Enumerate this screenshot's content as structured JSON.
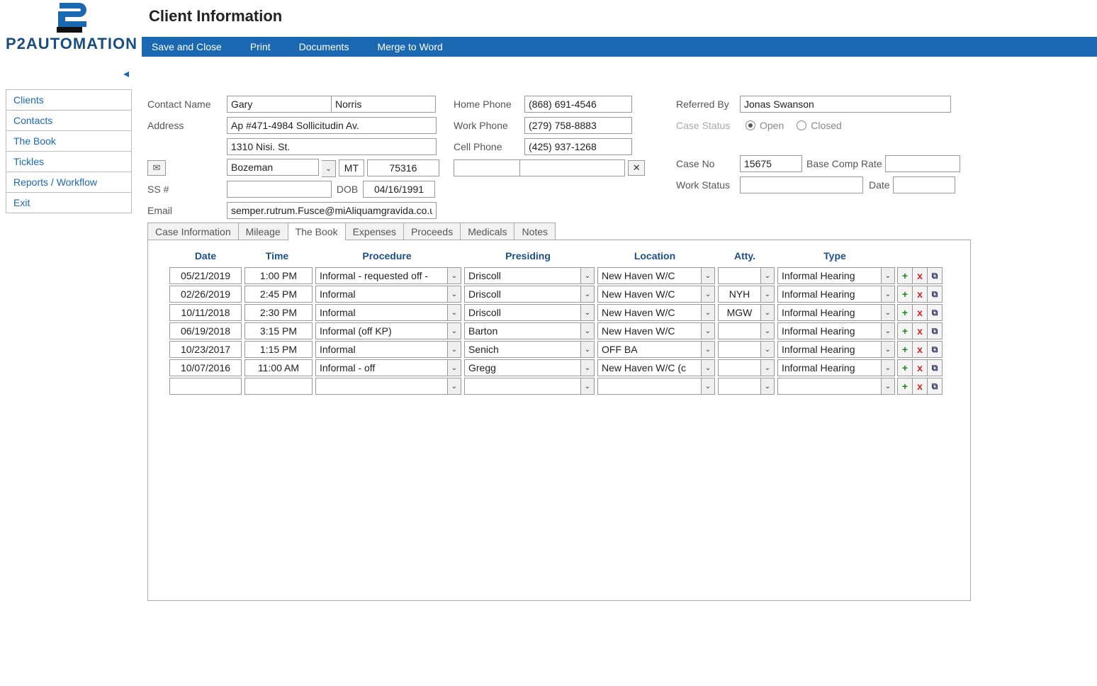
{
  "brand": "P2AUTOMATION",
  "page_title": "Client Information",
  "toolbar": {
    "save_close": "Save and Close",
    "print": "Print",
    "documents": "Documents",
    "merge_word": "Merge to Word"
  },
  "sidebar": {
    "items": [
      {
        "label": "Clients"
      },
      {
        "label": "Contacts"
      },
      {
        "label": "The Book"
      },
      {
        "label": "Tickles"
      },
      {
        "label": "Reports / Workflow"
      },
      {
        "label": "Exit"
      }
    ]
  },
  "labels": {
    "contact_name": "Contact Name",
    "address": "Address",
    "ssn": "SS #",
    "dob": "DOB",
    "email": "Email",
    "home_phone": "Home Phone",
    "work_phone": "Work Phone",
    "cell_phone": "Cell Phone",
    "referred_by": "Referred By",
    "case_status": "Case Status",
    "open": "Open",
    "closed": "Closed",
    "case_no": "Case No",
    "base_comp_rate": "Base Comp Rate",
    "work_status": "Work Status",
    "date": "Date"
  },
  "client": {
    "first_name": "Gary",
    "last_name": "Norris",
    "address1": "Ap #471-4984 Sollicitudin Av.",
    "address2": "1310 Nisi. St.",
    "city": "Bozeman",
    "state": "MT",
    "zip": "75316",
    "ssn": "",
    "dob": "04/16/1991",
    "email": "semper.rutrum.Fusce@miAliquamgravida.co.uk",
    "home_phone": "(868) 691-4546",
    "work_phone": "(279) 758-8883",
    "cell_phone": "(425) 937-1268",
    "phone4": "",
    "phone5": "",
    "referred_by": "Jonas Swanson",
    "case_status": "Open",
    "case_no": "15675",
    "base_comp_rate": "",
    "work_status": "",
    "work_status_date": ""
  },
  "tabs": [
    {
      "label": "Case Information"
    },
    {
      "label": "Mileage"
    },
    {
      "label": "The Book"
    },
    {
      "label": "Expenses"
    },
    {
      "label": "Proceeds"
    },
    {
      "label": "Medicals"
    },
    {
      "label": "Notes"
    }
  ],
  "active_tab": 2,
  "grid": {
    "headers": {
      "date": "Date",
      "time": "Time",
      "procedure": "Procedure",
      "presiding": "Presiding",
      "location": "Location",
      "atty": "Atty.",
      "type": "Type"
    },
    "rows": [
      {
        "date": "05/21/2019",
        "time": "1:00 PM",
        "procedure": "Informal - requested off -",
        "presiding": "Driscoll",
        "location": "New Haven  W/C",
        "atty": "",
        "type": "Informal Hearing"
      },
      {
        "date": "02/26/2019",
        "time": "2:45 PM",
        "procedure": "Informal",
        "presiding": "Driscoll",
        "location": "New Haven  W/C",
        "atty": "NYH",
        "type": "Informal Hearing"
      },
      {
        "date": "10/11/2018",
        "time": "2:30 PM",
        "procedure": "Informal",
        "presiding": "Driscoll",
        "location": "New Haven  W/C",
        "atty": "MGW",
        "type": "Informal Hearing"
      },
      {
        "date": "06/19/2018",
        "time": "3:15 PM",
        "procedure": "Informal (off KP)",
        "presiding": "Barton",
        "location": "New Haven  W/C",
        "atty": "",
        "type": "Informal Hearing"
      },
      {
        "date": "10/23/2017",
        "time": "1:15 PM",
        "procedure": "Informal",
        "presiding": "Senich",
        "location": "OFF BA",
        "atty": "",
        "type": "Informal Hearing"
      },
      {
        "date": "10/07/2016",
        "time": "11:00 AM",
        "procedure": "Informal - off",
        "presiding": "Gregg",
        "location": "New Haven  W/C (c",
        "atty": "",
        "type": "Informal Hearing"
      },
      {
        "date": "",
        "time": "",
        "procedure": "",
        "presiding": "",
        "location": "",
        "atty": "",
        "type": ""
      }
    ]
  },
  "icons": {
    "plus": "+",
    "x": "x",
    "copy": "⧉",
    "dropdown": "⌄",
    "collapse": "◂",
    "envelope": "✉",
    "clear": "✕"
  }
}
